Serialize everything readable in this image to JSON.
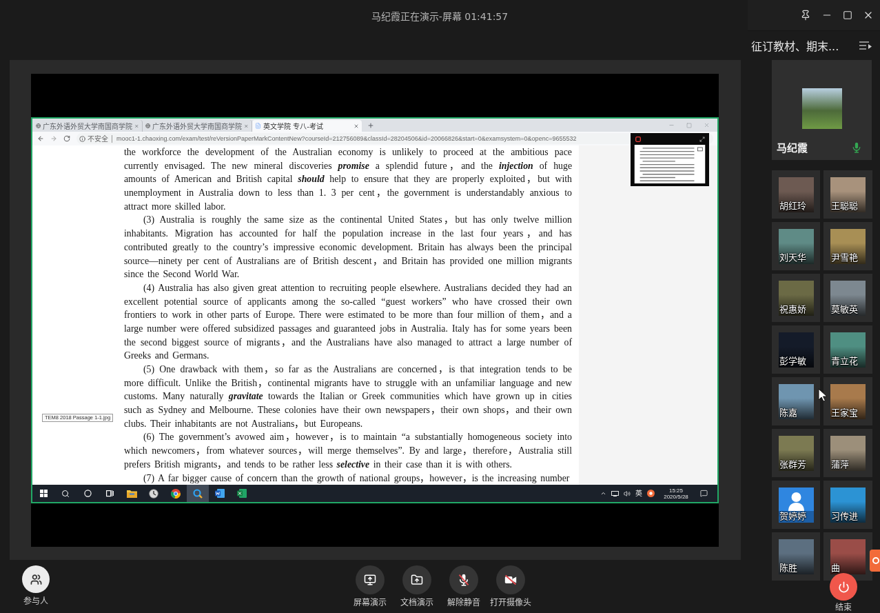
{
  "window": {
    "title": "马纪霞正在演示-屏幕 01:41:57"
  },
  "shared_screen": {
    "browser": {
      "tabs": [
        {
          "kind": "site",
          "title": "广东外语外贸大学南国商学院",
          "selected": false
        },
        {
          "kind": "site",
          "title": "广东外语外贸大学南国商学院",
          "selected": false
        },
        {
          "kind": "page",
          "title": "英文学院 专八-考试",
          "selected": true
        }
      ],
      "address_bar": {
        "security": "不安全",
        "url": "mooc1-1.chaoxing.com/exam/test/reVersionPaperMarkContentNew?courseId=212756089&classId=28204506&id=20066826&start=0&examsystem=0&openc=9655532"
      }
    },
    "document": {
      "paragraphs": [
        {
          "indent": false,
          "text": "the workforce the development of the Australian economy is unlikely to proceed at the ambitious pace currently envisaged. The new mineral discoveries **promise** a splendid future，and the **injection** of huge amounts of American and British capital **should** help to ensure that they are properly exploited，but with unemployment in Australia down to less than 1. 3 per cent，the government is understandably anxious to attract more skilled labor."
        },
        {
          "indent": true,
          "text": "(3) Australia is roughly the same size as the continental United States，but has only twelve million inhabitants. Migration has accounted for half the population increase in the last four years，and has contributed greatly to the country’s impressive economic development. Britain has always been the principal source—ninety per cent of Australians are of British descent，and Britain has provided one million migrants since the Second World War."
        },
        {
          "indent": true,
          "text": "(4) Australia has also given great attention to recruiting people elsewhere. Australians decided they had an excellent potential source of applicants among the so-called “guest workers” who have crossed their own frontiers to work in other parts of Europe. There were estimated to be more than four million of them，and a large number were offered subsidized passages and guaranteed jobs in Australia. Italy has for some years been the second biggest source of migrants，and the Australians have also managed to attract a large number of Greeks and Germans."
        },
        {
          "indent": true,
          "text": "(5) One drawback with them，so far as the Australians are concerned，is that integration tends to be more difficult. Unlike the British，continental migrants have to struggle with an unfamiliar language and new customs. Many naturally **gravitate** towards the Italian or Greek communities which have grown up in cities such as Sydney and Melbourne. These colonies have their own newspapers，their own shops，and their own clubs. Their inhabitants are not Australians，but Europeans."
        },
        {
          "indent": true,
          "text": "(6) The government’s avowed aim，however，is to maintain “a substantially homogeneous society into which newcomers，from whatever sources，will merge themselves”. By and large，therefore，Australia still prefers British migrants，and tends to be rather less **selective** in their case than it is with others."
        },
        {
          "indent": true,
          "text": "(7) A far bigger cause of concern than the growth of national groups，however，is the increasing number"
        }
      ]
    },
    "tooltip": "TEM8 2018 Passage 1-1.jpg",
    "taskbar": {
      "apps": [
        {
          "kind": "start",
          "active": false
        },
        {
          "kind": "search",
          "active": false
        },
        {
          "kind": "cortana",
          "active": false
        },
        {
          "kind": "task_view",
          "active": false
        },
        {
          "kind": "explorer",
          "active": false
        },
        {
          "kind": "clock",
          "active": false
        },
        {
          "kind": "chrome",
          "active": false
        },
        {
          "kind": "finder",
          "active": true
        },
        {
          "kind": "word",
          "active": false
        },
        {
          "kind": "excel",
          "active": false
        }
      ],
      "ime": "英",
      "time": "15:25",
      "date": "2020/5/28"
    }
  },
  "sidebar": {
    "meeting_title": "征订教材、期末...",
    "presenter": {
      "name": "马纪霞",
      "mic_on": true
    },
    "participants": [
      {
        "name": "胡红玲",
        "kind": "photo"
      },
      {
        "name": "王聪聪",
        "kind": "photo"
      },
      {
        "name": "刘天华",
        "kind": "photo"
      },
      {
        "name": "尹雪艳",
        "kind": "photo"
      },
      {
        "name": "祝惠娇",
        "kind": "photo"
      },
      {
        "name": "莫敏英",
        "kind": "photo"
      },
      {
        "name": "彭学敏",
        "kind": "photo"
      },
      {
        "name": "青立花",
        "kind": "photo"
      },
      {
        "name": "陈嘉",
        "kind": "photo"
      },
      {
        "name": "王家宝",
        "kind": "photo"
      },
      {
        "name": "张群芳",
        "kind": "photo"
      },
      {
        "name": "蒲萍",
        "kind": "photo"
      },
      {
        "name": "贺婷婷",
        "kind": "default"
      },
      {
        "name": "习传进",
        "kind": "photo"
      },
      {
        "name": "陈胜",
        "kind": "photo"
      },
      {
        "name": "曲",
        "kind": "photo"
      }
    ]
  },
  "toolbar": {
    "participants": "参与人",
    "actions": [
      {
        "kind": "screen",
        "label": "屏幕演示"
      },
      {
        "kind": "document",
        "label": "文档演示"
      },
      {
        "kind": "mic",
        "label": "解除静音",
        "muted": true
      },
      {
        "kind": "camera",
        "label": "打开摄像头",
        "off": true
      }
    ],
    "end": "结束"
  }
}
